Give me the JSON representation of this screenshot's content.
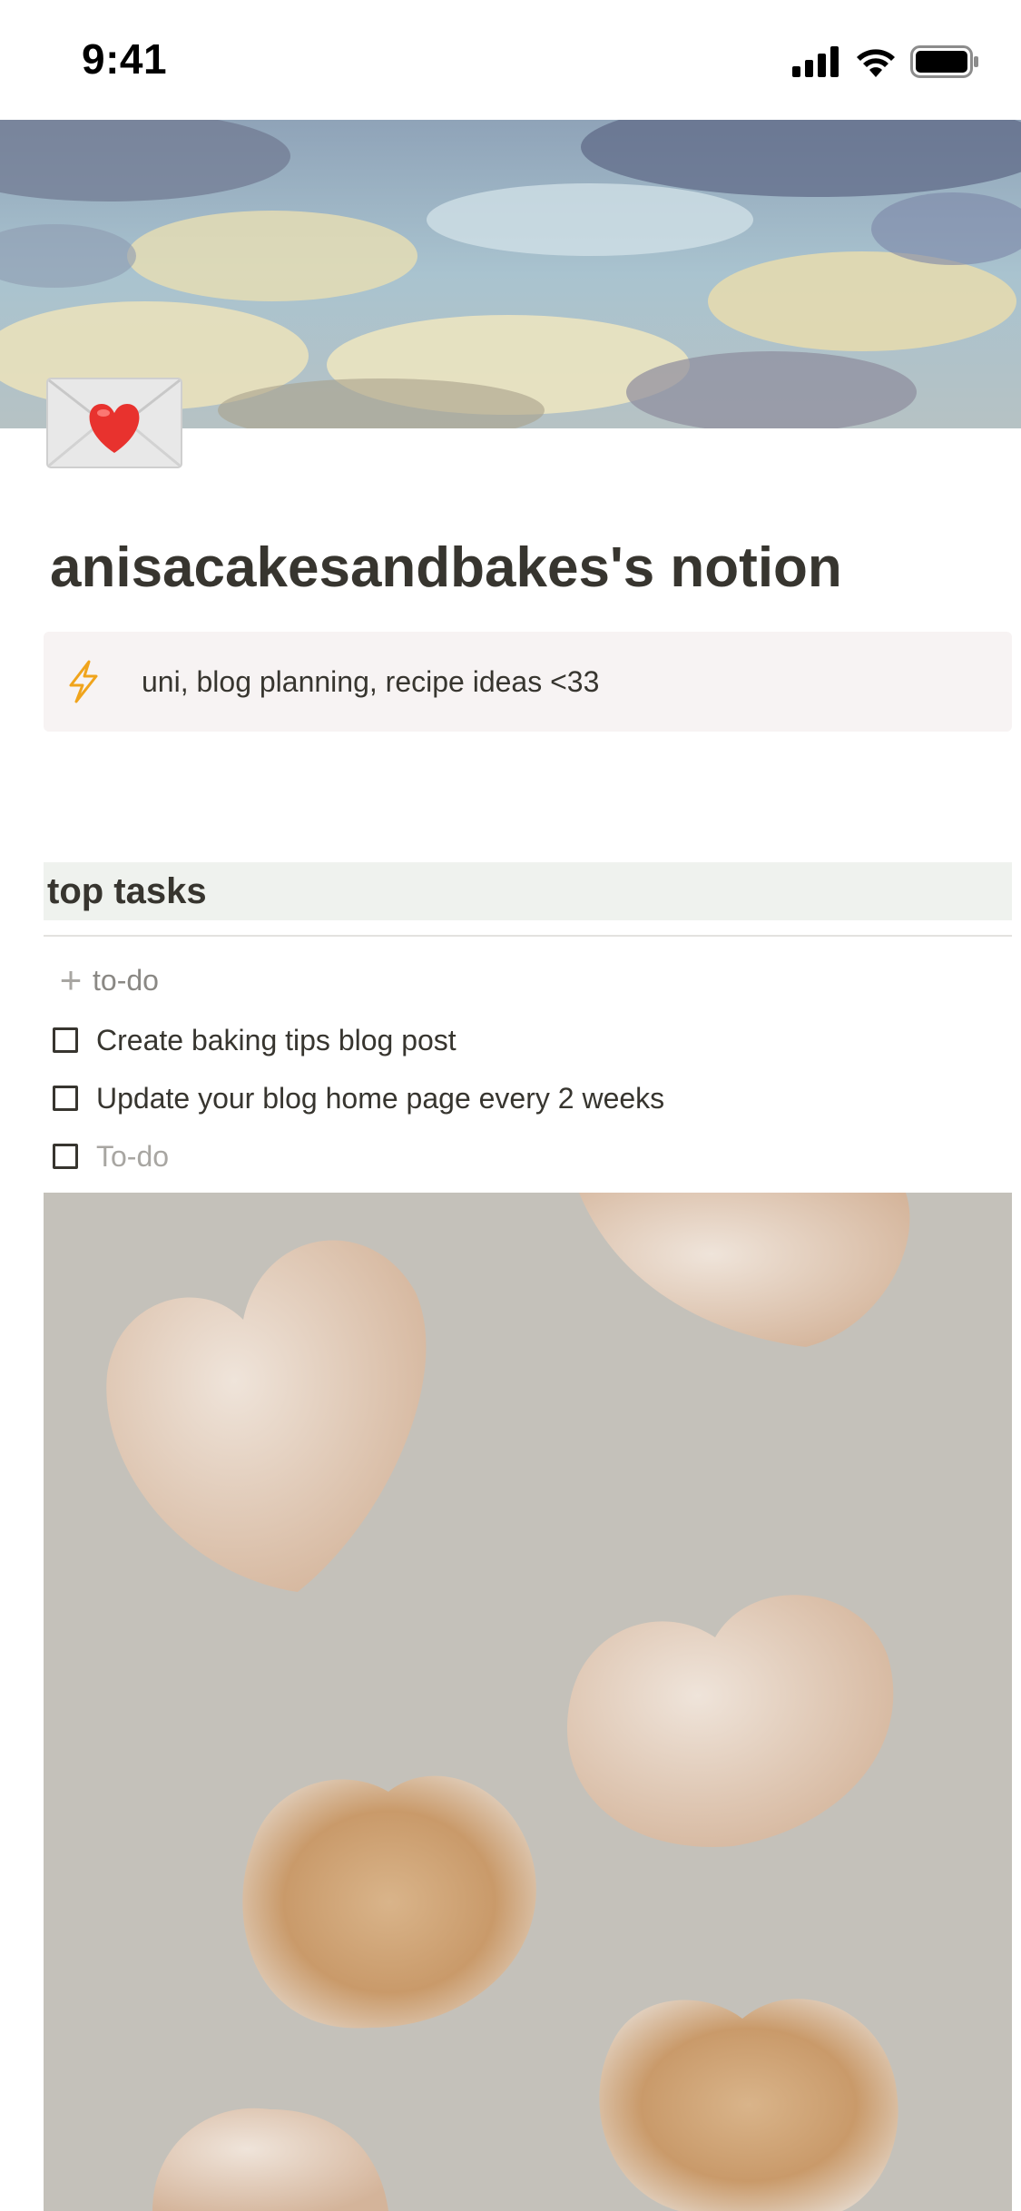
{
  "status_bar": {
    "time": "9:41",
    "signal_icon": "cellular-signal-icon",
    "wifi_icon": "wifi-icon",
    "battery_icon": "battery-icon"
  },
  "cover": {
    "description_icon": "cover-image"
  },
  "page": {
    "icon": "love-letter-icon",
    "title": "anisacakesandbakes's notion"
  },
  "callout": {
    "icon": "lightning-icon",
    "text": "uni, blog planning, recipe ideas <33"
  },
  "tasks_section": {
    "heading": "top tasks",
    "add_label": "to-do",
    "items": [
      {
        "text": "Create baking tips blog post",
        "checked": false
      },
      {
        "text": "Update your blog home page every 2 weeks",
        "checked": false
      }
    ],
    "placeholder": "To-do"
  },
  "colors": {
    "text": "#37352f",
    "callout_bg": "#f7f3f3",
    "heading_bg": "#eff2ee",
    "muted": "#a8a6a2"
  }
}
